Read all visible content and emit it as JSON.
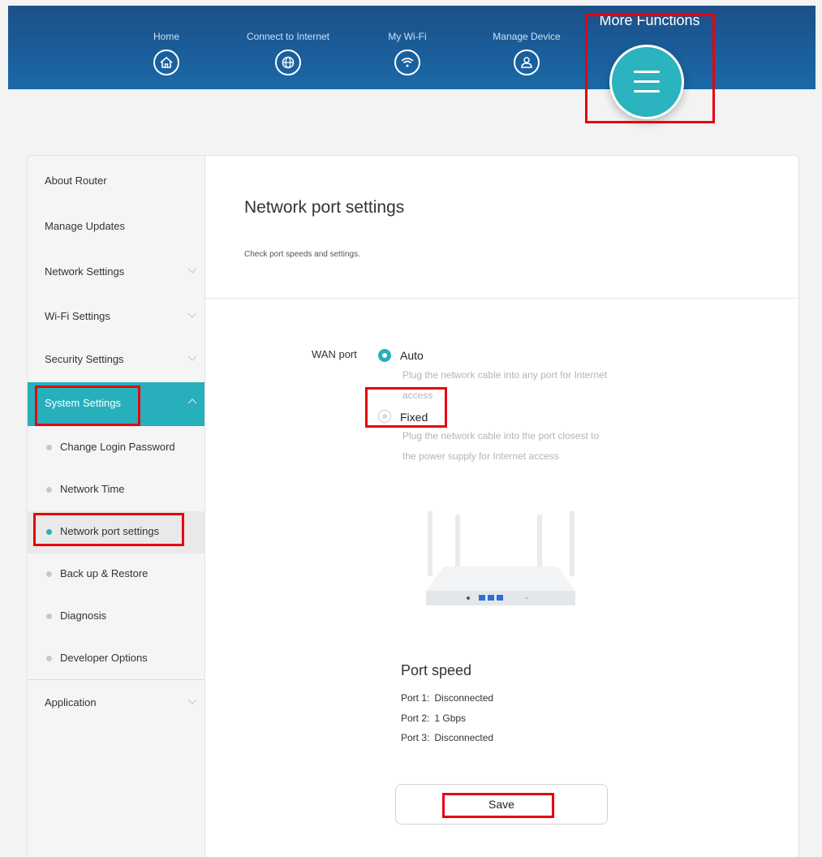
{
  "nav": {
    "items": [
      {
        "label": "Home",
        "icon": "home-icon"
      },
      {
        "label": "Connect to Internet",
        "icon": "globe-icon"
      },
      {
        "label": "My Wi-Fi",
        "icon": "wifi-icon"
      },
      {
        "label": "Manage Device",
        "icon": "user-icon"
      }
    ],
    "more_label": "More Functions",
    "more_icon": "menu-icon"
  },
  "sidebar": {
    "items": [
      {
        "label": "About Router"
      },
      {
        "label": "Manage Updates"
      },
      {
        "label": "Network Settings"
      },
      {
        "label": "Wi-Fi Settings"
      },
      {
        "label": "Security Settings"
      },
      {
        "label": "System Settings"
      }
    ],
    "sub_items": [
      {
        "label": "Change Login Password"
      },
      {
        "label": "Network Time"
      },
      {
        "label": "Network port settings"
      },
      {
        "label": "Back up & Restore"
      },
      {
        "label": "Diagnosis"
      },
      {
        "label": "Developer Options"
      }
    ],
    "application": "Application"
  },
  "main": {
    "title": "Network port settings",
    "subtitle": "Check port speeds and settings.",
    "wan_label": "WAN port",
    "options": [
      {
        "label": "Auto",
        "desc_line1": "Plug the network cable into any port for Internet",
        "desc_line2": "access",
        "selected": true
      },
      {
        "label": "Fixed",
        "desc_line1": "Plug the network cable into the port closest to",
        "desc_line2": "the power supply for Internet access",
        "selected": false
      }
    ],
    "port_speed_title": "Port speed",
    "ports": [
      {
        "name": "Port 1:",
        "status": "Disconnected"
      },
      {
        "name": "Port 2:",
        "status": "1 Gbps"
      },
      {
        "name": "Port 3:",
        "status": "Disconnected"
      }
    ],
    "save_label": "Save"
  },
  "colors": {
    "accent": "#27b0bc",
    "header": "#1b5f9c",
    "highlight": "#e6000f"
  }
}
